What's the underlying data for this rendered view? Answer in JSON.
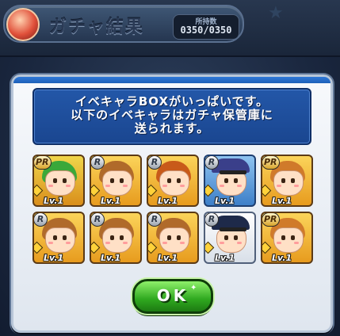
{
  "header": {
    "title": "ガチャ結果",
    "count_label": "所持数",
    "count_value": "0350/0350"
  },
  "dialog": {
    "message_lines": [
      "イベキャラBOXがいっぱいです。",
      "以下のイベキャラはガチャ保管庫に",
      "送られます。"
    ],
    "ok_label": "OK"
  },
  "characters": [
    {
      "rarity": "PR",
      "level": "Lv.1",
      "hair": "#3aa83a"
    },
    {
      "rarity": "R",
      "level": "Lv.1",
      "hair": "#b06a2a"
    },
    {
      "rarity": "R",
      "level": "Lv.1",
      "hair": "#c85a1a"
    },
    {
      "rarity": "R",
      "level": "Lv.1",
      "hair": "#3a3f8a"
    },
    {
      "rarity": "PR",
      "level": "Lv.1",
      "hair": "#d07a2a"
    },
    {
      "rarity": "R",
      "level": "Lv.1",
      "hair": "#b06a2a"
    },
    {
      "rarity": "R",
      "level": "Lv.1",
      "hair": "#b06a2a"
    },
    {
      "rarity": "R",
      "level": "Lv.1",
      "hair": "#b06a2a"
    },
    {
      "rarity": "R",
      "level": "Lv.1",
      "hair": "#1e2a4a"
    },
    {
      "rarity": "PR",
      "level": "Lv.1",
      "hair": "#d07a2a"
    }
  ],
  "colors": {
    "dialog_message_bg": "#2357a8",
    "ok_button": "#2fa81f"
  }
}
